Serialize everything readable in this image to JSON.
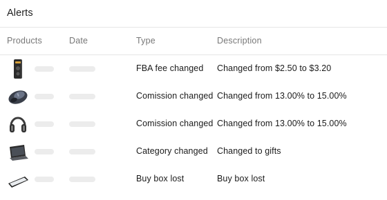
{
  "card": {
    "title": "Alerts"
  },
  "columns": [
    "Products",
    "Date",
    "Type",
    "Description"
  ],
  "rows": [
    {
      "product_icon": "speaker-device-icon",
      "type": "FBA fee changed",
      "description": "Changed from $2.50 to $3.20"
    },
    {
      "product_icon": "computer-mouse-icon",
      "type": "Comission changed",
      "description": "Changed from 13.00% to 15.00%"
    },
    {
      "product_icon": "headphones-icon",
      "type": "Comission changed",
      "description": "Changed from 13.00% to 15.00%"
    },
    {
      "product_icon": "laptop-icon",
      "type": "Category changed",
      "description": "Changed to gifts"
    },
    {
      "product_icon": "tablet-icon",
      "type": "Buy box lost",
      "description": "Buy box lost"
    }
  ]
}
